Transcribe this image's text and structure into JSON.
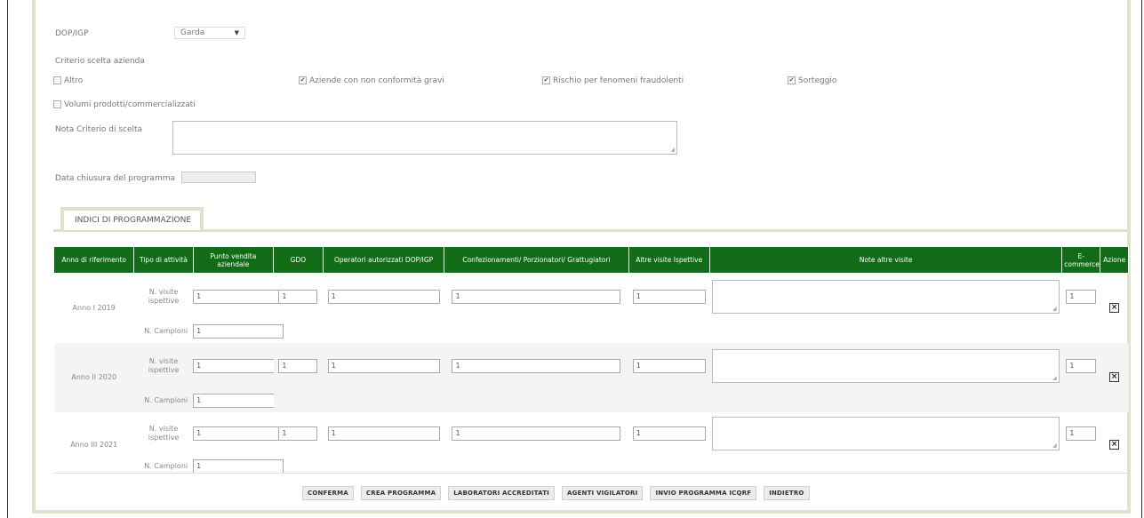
{
  "form": {
    "dop_igp_label": "DOP/IGP",
    "dop_igp_value": "Garda",
    "criterio_label": "Criterio scelta azienda",
    "criteria": [
      {
        "label": "Altro",
        "checked": false
      },
      {
        "label": "Aziende con non conformità gravi",
        "checked": true
      },
      {
        "label": "Rischio per fenomeni fraudolenti",
        "checked": true
      },
      {
        "label": "Sorteggio",
        "checked": true
      },
      {
        "label": "Volumi prodotti/commercializzati",
        "checked": false
      }
    ],
    "nota_label": "Nota Criterio di scelta",
    "data_chiusura_label": "Data chiusura del programma"
  },
  "tab": {
    "label": "INDICI DI PROGRAMMAZIONE"
  },
  "table": {
    "headers": [
      "Anno di riferimento",
      "Tipo di attività",
      "Punto vendita aziendale",
      "GDO",
      "Operatori autorizzati DOP/IGP",
      "Confezionamenti/ Porzionatori/ Grattugiatori",
      "Altre visite Ispettive",
      "Note altre visite",
      "E-commerce",
      "Azione"
    ],
    "rows": [
      {
        "year": "Anno I 2019",
        "type_visite": "N. visite ispettive",
        "type_campioni": "N. Campioni",
        "punto": "1",
        "gdo": "1",
        "operatori": "1",
        "confez": "1",
        "altre": "1",
        "ecommerce": "1",
        "campioni": "1"
      },
      {
        "year": "Anno II 2020",
        "type_visite": "N. visite ispettive",
        "type_campioni": "N. Campioni",
        "punto": "1",
        "gdo": "1",
        "operatori": "1",
        "confez": "1",
        "altre": "1",
        "ecommerce": "1",
        "campioni": "1"
      },
      {
        "year": "Anno III 2021",
        "type_visite": "N. visite ispettive",
        "type_campioni": "N. Campioni",
        "punto": "1",
        "gdo": "1",
        "operatori": "1",
        "confez": "1",
        "altre": "1",
        "ecommerce": "1",
        "campioni": "1"
      }
    ],
    "delete_glyph": "×"
  },
  "buttons": {
    "conferma": "CONFERMA",
    "crea": "CREA PROGRAMMA",
    "laboratori": "LABORATORI ACCREDITATI",
    "agenti": "AGENTI VIGILATORI",
    "invio": "INVIO PROGRAMMA ICQRF",
    "indietro": "INDIETRO"
  },
  "colors": {
    "header_green": "#126b17",
    "panel_border": "#dfe3cc"
  }
}
